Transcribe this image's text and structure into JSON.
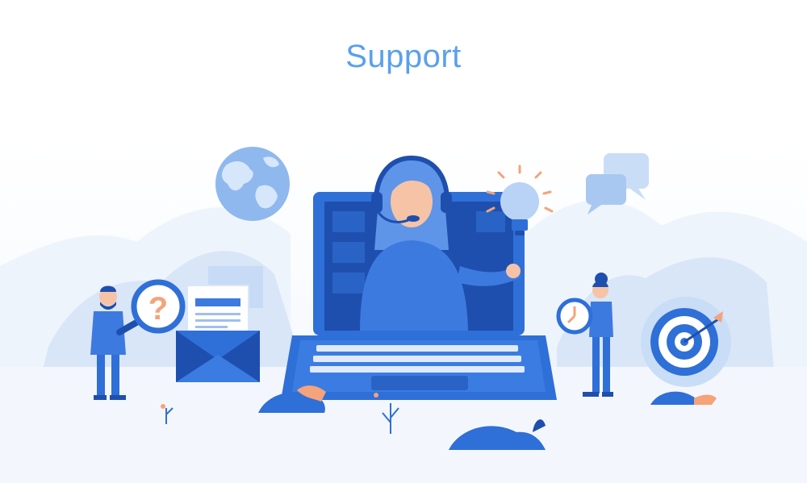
{
  "page": {
    "title": "Support"
  },
  "colors": {
    "title": "#5aa0ec",
    "primary": "#2f6fd8",
    "dark": "#1f4fae",
    "light": "#d8e6fa",
    "pale": "#eaf2fc",
    "accent": "#f4a37a",
    "skin": "#f7c3a6"
  },
  "icons": [
    "globe-icon",
    "chat-bubbles-icon",
    "lightbulb-icon",
    "question-mark-icon",
    "envelope-icon",
    "clock-icon",
    "target-icon",
    "headset-icon"
  ]
}
